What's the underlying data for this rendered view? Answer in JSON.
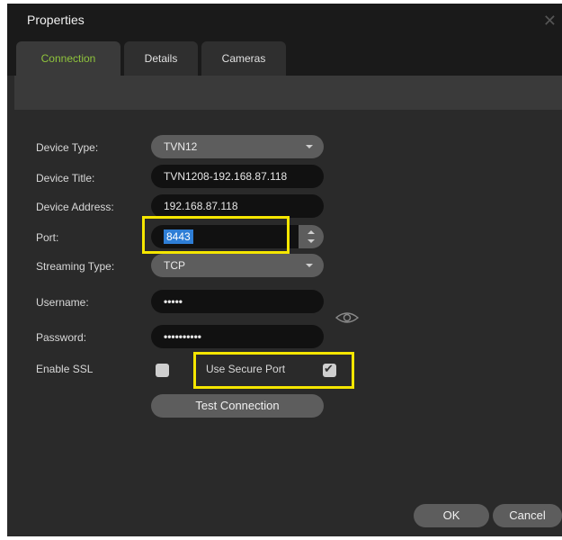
{
  "window": {
    "title": "Properties"
  },
  "tabs": [
    {
      "label": "Connection",
      "active": true
    },
    {
      "label": "Details",
      "active": false
    },
    {
      "label": "Cameras",
      "active": false
    }
  ],
  "form": {
    "device_type": {
      "label": "Device Type:",
      "value": "TVN12"
    },
    "device_title": {
      "label": "Device Title:",
      "value": "TVN1208-192.168.87.118"
    },
    "device_address": {
      "label": "Device Address:",
      "value": "192.168.87.118"
    },
    "port": {
      "label": "Port:",
      "value": "8443"
    },
    "streaming_type": {
      "label": "Streaming Type:",
      "value": "TCP"
    },
    "username": {
      "label": "Username:",
      "value": "•••••"
    },
    "password": {
      "label": "Password:",
      "value": "••••••••••"
    },
    "enable_ssl": {
      "label": "Enable SSL",
      "checked": false
    },
    "use_secure_port": {
      "label": "Use Secure Port",
      "checked": true
    },
    "test_connection": "Test Connection"
  },
  "footer": {
    "ok": "OK",
    "cancel": "Cancel"
  },
  "colors": {
    "accent_tab": "#8fc43c",
    "highlight": "#f5e600",
    "selection": "#2e7ed6"
  },
  "icons": {
    "close": "close-icon",
    "eye": "eye-icon",
    "check": "checkmark-icon"
  }
}
